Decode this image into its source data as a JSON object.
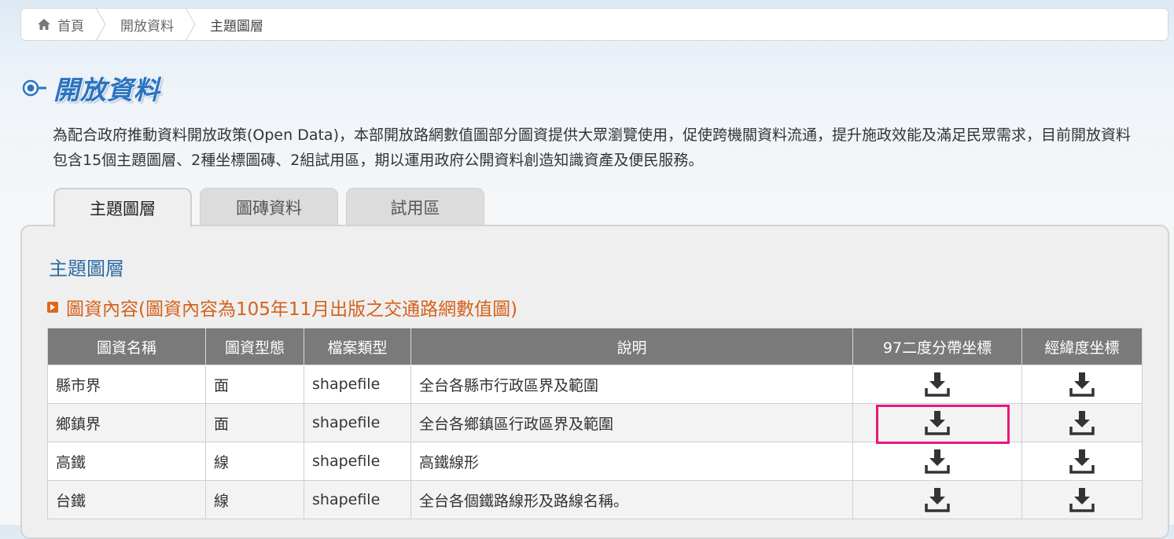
{
  "breadcrumb": {
    "home": "首頁",
    "open_data": "開放資料",
    "current": "主題圖層"
  },
  "page_title": "開放資料",
  "intro": "為配合政府推動資料開放政策(Open Data)，本部開放路網數值圖部分圖資提供大眾瀏覽使用，促使跨機關資料流通，提升施政效能及滿足民眾需求，目前開放資料包含15個主題圖層、2種坐標圖磚、2組試用區，期以運用政府公開資料創造知識資產及便民服務。",
  "tabs": [
    "主題圖層",
    "圖磚資料",
    "試用區"
  ],
  "section_title": "主題圖層",
  "subtitle": "圖資內容(圖資內容為105年11月出版之交通路網數值圖)",
  "table": {
    "headers": [
      "圖資名稱",
      "圖資型態",
      "檔案類型",
      "說明",
      "97二度分帶坐標",
      "經緯度坐標"
    ],
    "rows": [
      [
        "縣市界",
        "面",
        "shapefile",
        "全台各縣市行政區界及範圍"
      ],
      [
        "鄉鎮界",
        "面",
        "shapefile",
        "全台各鄉鎮區行政區界及範圍"
      ],
      [
        "高鐵",
        "線",
        "shapefile",
        "高鐵線形"
      ],
      [
        "台鐵",
        "線",
        "shapefile",
        "全台各個鐵路線形及路線名稱。"
      ]
    ]
  },
  "colors": {
    "title_blue": "#2a73c0",
    "section_blue": "#2b6ca3",
    "subtitle_orange": "#d4621b",
    "header_gray": "#7a7a7a",
    "highlight_pink": "#e6197d"
  },
  "icons": {
    "home": "home-icon",
    "download": "download-icon",
    "title_bullet": "eye-bullet-icon",
    "subtitle_bullet": "play-square-icon"
  }
}
